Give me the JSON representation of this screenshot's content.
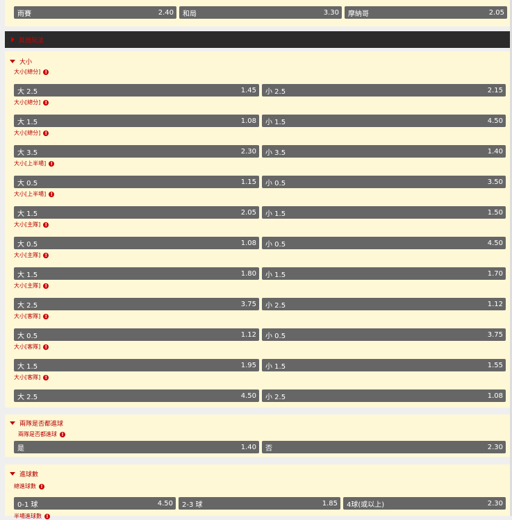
{
  "top_row": [
    {
      "label": "雨賽",
      "odds": "2.40"
    },
    {
      "label": "和局",
      "odds": "3.30"
    },
    {
      "label": "摩納哥",
      "odds": "2.05"
    }
  ],
  "other_plays_label": "其他玩法",
  "ou_section": {
    "title": "大小",
    "markets": [
      {
        "sub": "大小[總分]",
        "over": "大 2.5",
        "over_odds": "1.45",
        "under": "小 2.5",
        "under_odds": "2.15"
      },
      {
        "sub": "大小[總分]",
        "over": "大 1.5",
        "over_odds": "1.08",
        "under": "小 1.5",
        "under_odds": "4.50"
      },
      {
        "sub": "大小[總分]",
        "over": "大 3.5",
        "over_odds": "2.30",
        "under": "小 3.5",
        "under_odds": "1.40"
      },
      {
        "sub": "大小[上半場]",
        "over": "大 0.5",
        "over_odds": "1.15",
        "under": "小 0.5",
        "under_odds": "3.50"
      },
      {
        "sub": "大小[上半場]",
        "over": "大 1.5",
        "over_odds": "2.05",
        "under": "小 1.5",
        "under_odds": "1.50"
      },
      {
        "sub": "大小[主隊]",
        "over": "大 0.5",
        "over_odds": "1.08",
        "under": "小 0.5",
        "under_odds": "4.50"
      },
      {
        "sub": "大小[主隊]",
        "over": "大 1.5",
        "over_odds": "1.80",
        "under": "小 1.5",
        "under_odds": "1.70"
      },
      {
        "sub": "大小[主隊]",
        "over": "大 2.5",
        "over_odds": "3.75",
        "under": "小 2.5",
        "under_odds": "1.12"
      },
      {
        "sub": "大小[客隊]",
        "over": "大 0.5",
        "over_odds": "1.12",
        "under": "小 0.5",
        "under_odds": "3.75"
      },
      {
        "sub": "大小[客隊]",
        "over": "大 1.5",
        "over_odds": "1.95",
        "under": "小 1.5",
        "under_odds": "1.55"
      },
      {
        "sub": "大小[客隊]",
        "over": "大 2.5",
        "over_odds": "4.50",
        "under": "小 2.5",
        "under_odds": "1.08"
      }
    ]
  },
  "btts_section": {
    "title": "兩隊是否都進球",
    "sub": "兩隊是否都進球",
    "yes": "是",
    "yes_odds": "1.40",
    "no": "否",
    "no_odds": "2.30"
  },
  "goals_section": {
    "title": "進球數",
    "sub": "總進球數",
    "opts": [
      {
        "label": "0-1 球",
        "odds": "4.50"
      },
      {
        "label": "2-3 球",
        "odds": "1.85"
      },
      {
        "label": "4球(或以上)",
        "odds": "2.30"
      }
    ],
    "next_sub": "半場進球數"
  },
  "info_glyph": "!"
}
